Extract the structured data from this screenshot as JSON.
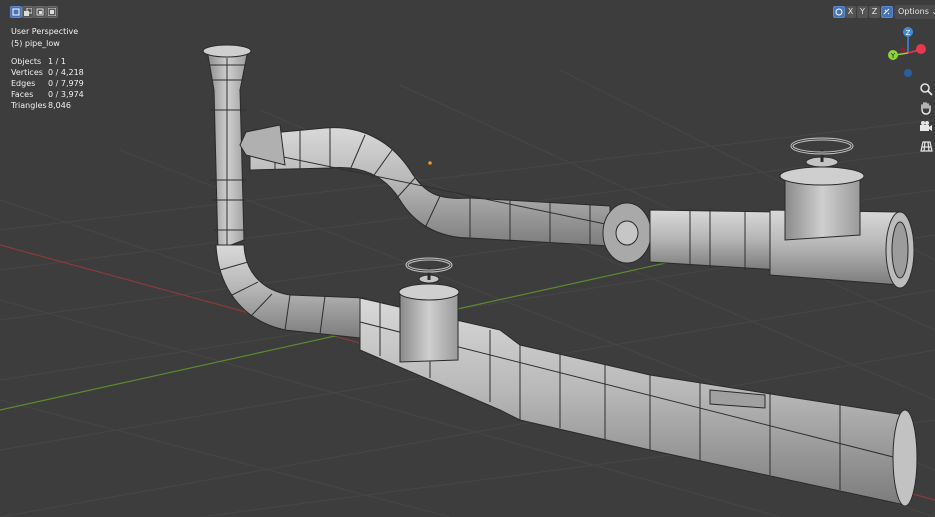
{
  "overlay": {
    "view_name": "User Perspective",
    "object_name": "(5) pipe_low"
  },
  "stats": [
    {
      "label": "Objects",
      "value": "1 / 1"
    },
    {
      "label": "Vertices",
      "value": "0 / 4,218"
    },
    {
      "label": "Edges",
      "value": "0 / 7,979"
    },
    {
      "label": "Faces",
      "value": "0 / 3,974"
    },
    {
      "label": "Triangles",
      "value": "8,046"
    }
  ],
  "header": {
    "axis_x": "X",
    "axis_y": "Y",
    "axis_z": "Z",
    "options_label": "Options",
    "options_chevron": "⌄"
  },
  "gizmo": {
    "z_label": "Z",
    "y_label": "Y",
    "x_color": "#e8384f",
    "y_color": "#8cd43e",
    "z_color": "#3f8bdb"
  },
  "nav_icons": [
    "zoom-icon",
    "hand-icon",
    "camera-icon",
    "grid-icon"
  ],
  "colors": {
    "background": "#3d3d3d",
    "grid_line": "#444444",
    "x_axis_line": "#8a3a3a",
    "y_axis_line": "#5b8a2e",
    "mesh_fill": "#b7b7b7",
    "mesh_wire": "#2a2a2a",
    "selection_accent": "#4772b3"
  }
}
